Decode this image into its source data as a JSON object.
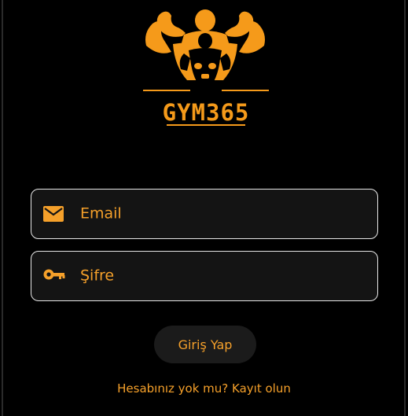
{
  "app": {
    "logo_text": "GYM365"
  },
  "form": {
    "email_placeholder": "Email",
    "password_placeholder": "Şifre",
    "login_label": "Giriş Yap",
    "signup_prompt": "Hesabınız yok mu? Kayıt olun"
  },
  "theme": {
    "accent": "#f5a02a",
    "background": "#000000",
    "field_border": "#e8e8e8",
    "button_bg": "#1b1b1b"
  },
  "icons": {
    "logo": "bodybuilder-logo",
    "email": "envelope-icon",
    "password": "key-icon"
  }
}
